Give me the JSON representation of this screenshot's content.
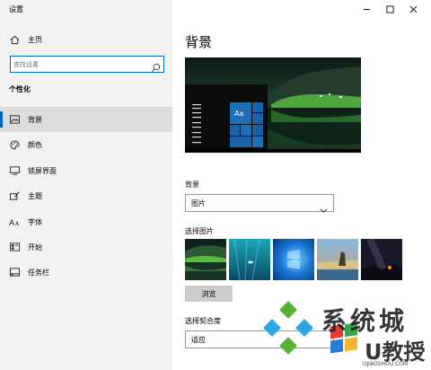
{
  "window": {
    "title": "设置"
  },
  "sidebar": {
    "home_label": "主页",
    "search_placeholder": "查找设置",
    "section_title": "个性化",
    "items": [
      {
        "label": "背景",
        "icon": "picture-icon"
      },
      {
        "label": "颜色",
        "icon": "palette-icon"
      },
      {
        "label": "锁屏界面",
        "icon": "lock-screen-icon"
      },
      {
        "label": "主题",
        "icon": "brush-icon"
      },
      {
        "label": "字体",
        "icon": "font-icon"
      },
      {
        "label": "开始",
        "icon": "start-icon"
      },
      {
        "label": "任务栏",
        "icon": "taskbar-icon"
      }
    ]
  },
  "main": {
    "title": "背景",
    "preview_tile_text": "Aa",
    "background_label": "背景",
    "background_value": "图片",
    "choose_picture_label": "选择图片",
    "browse_label": "浏览",
    "fit_label": "选择契合度",
    "fit_value": "适应"
  },
  "watermark": {
    "line1": "系统城",
    "line2": "U教授",
    "url": "UJIAOSHOU.COM"
  },
  "colors": {
    "accent": "#0067c0",
    "sidebar_bg": "#f2f2f2",
    "selected_bg": "#dcdcdc"
  }
}
